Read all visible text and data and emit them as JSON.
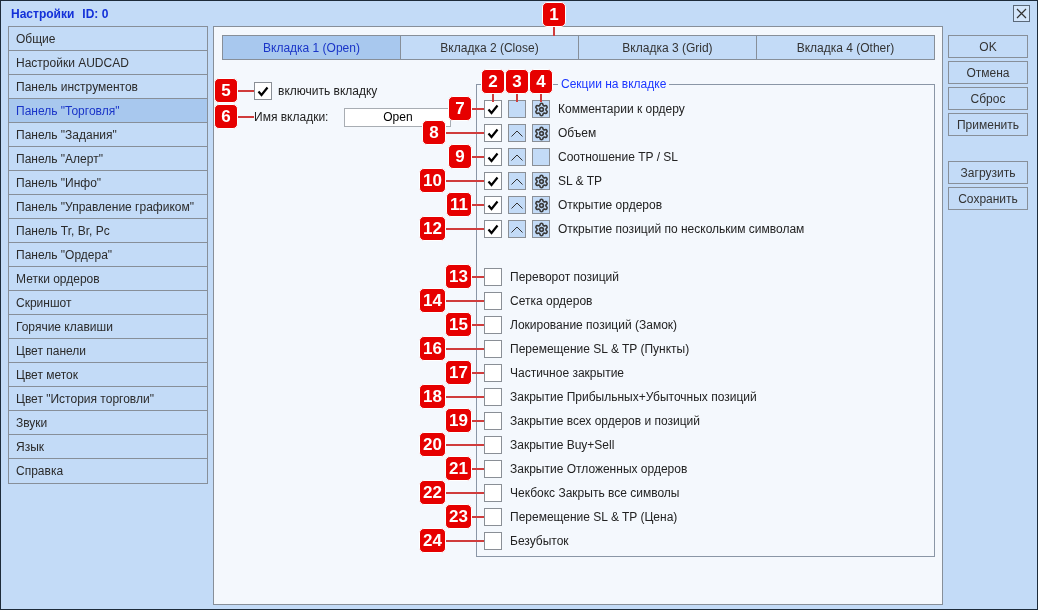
{
  "window": {
    "title": "Настройки",
    "id_label": "ID: 0"
  },
  "sidebar": {
    "items": [
      {
        "label": "Общие",
        "selected": false
      },
      {
        "label": "Настройки AUDCAD",
        "selected": false
      },
      {
        "label": "Панель инструментов",
        "selected": false
      },
      {
        "label": "Панель \"Торговля\"",
        "selected": true
      },
      {
        "label": "Панель \"Задания\"",
        "selected": false
      },
      {
        "label": "Панель \"Алерт\"",
        "selected": false
      },
      {
        "label": "Панель \"Инфо\"",
        "selected": false
      },
      {
        "label": "Панель \"Управление графиком\"",
        "selected": false
      },
      {
        "label": "Панель Tr, Br, Pc",
        "selected": false
      },
      {
        "label": "Панель \"Ордера\"",
        "selected": false
      },
      {
        "label": "Метки ордеров",
        "selected": false
      },
      {
        "label": "Скриншот",
        "selected": false
      },
      {
        "label": "Горячие клавиши",
        "selected": false
      },
      {
        "label": "Цвет панели",
        "selected": false
      },
      {
        "label": "Цвет меток",
        "selected": false
      },
      {
        "label": "Цвет \"История торговли\"",
        "selected": false
      },
      {
        "label": "Звуки",
        "selected": false
      },
      {
        "label": "Язык",
        "selected": false
      },
      {
        "label": "Справка",
        "selected": false
      }
    ]
  },
  "tabs": [
    {
      "label": "Вкладка 1 (Open)",
      "selected": true
    },
    {
      "label": "Вкладка 2 (Close)",
      "selected": false,
      "callout": "1"
    },
    {
      "label": "Вкладка 3 (Grid)",
      "selected": false
    },
    {
      "label": "Вкладка 4 (Other)",
      "selected": false
    }
  ],
  "enable_tab": {
    "label": "включить вкладку",
    "checked": true,
    "callout": "5"
  },
  "tab_name": {
    "label": "Имя вкладки:",
    "value": "Open",
    "callout": "6"
  },
  "sections": {
    "title": "Секции на вкладке",
    "column_callouts": [
      "2",
      "3",
      "4"
    ],
    "rows": [
      {
        "kind": "section",
        "label": "Комментарии к ордеру",
        "checked": true,
        "arrow": false,
        "gear": true,
        "callout": "7"
      },
      {
        "kind": "section",
        "label": "Объем",
        "checked": true,
        "arrow": true,
        "gear": true,
        "callout": "8"
      },
      {
        "kind": "section",
        "label": "Соотношение TP / SL",
        "checked": true,
        "arrow": true,
        "gear": false,
        "callout": "9"
      },
      {
        "kind": "section",
        "label": "SL & TP",
        "checked": true,
        "arrow": true,
        "gear": true,
        "callout": "10"
      },
      {
        "kind": "section",
        "label": "Открытие ордеров",
        "checked": true,
        "arrow": true,
        "gear": true,
        "callout": "11"
      },
      {
        "kind": "section",
        "label": "Открытие позиций по нескольким символам",
        "checked": true,
        "arrow": true,
        "gear": true,
        "callout": "12"
      },
      {
        "kind": "option",
        "label": "Переворот позиций",
        "checked": false,
        "callout": "13"
      },
      {
        "kind": "option",
        "label": "Сетка ордеров",
        "checked": false,
        "callout": "14"
      },
      {
        "kind": "option",
        "label": "Локирование позиций (Замок)",
        "checked": false,
        "callout": "15"
      },
      {
        "kind": "option",
        "label": "Перемещение SL & TP (Пункты)",
        "checked": false,
        "callout": "16"
      },
      {
        "kind": "option",
        "label": "Частичное закрытие",
        "checked": false,
        "callout": "17"
      },
      {
        "kind": "option",
        "label": "Закрытие Прибыльных+Убыточных позиций",
        "checked": false,
        "callout": "18"
      },
      {
        "kind": "option",
        "label": "Закрытие всех ордеров и позиций",
        "checked": false,
        "callout": "19"
      },
      {
        "kind": "option",
        "label": "Закрытие Buy+Sell",
        "checked": false,
        "callout": "20"
      },
      {
        "kind": "option",
        "label": "Закрытие Отложенных ордеров",
        "checked": false,
        "callout": "21"
      },
      {
        "kind": "option",
        "label": "Чекбокс Закрыть все символы",
        "checked": false,
        "callout": "22"
      },
      {
        "kind": "option",
        "label": "Перемещение SL & TP (Цена)",
        "checked": false,
        "callout": "23"
      },
      {
        "kind": "option",
        "label": "Безубыток",
        "checked": false,
        "callout": "24"
      }
    ]
  },
  "button_groups": [
    {
      "buttons": [
        "OK",
        "Отмена",
        "Сброс",
        "Применить"
      ]
    },
    {
      "buttons": [
        "Загрузить",
        "Сохранить"
      ]
    }
  ]
}
